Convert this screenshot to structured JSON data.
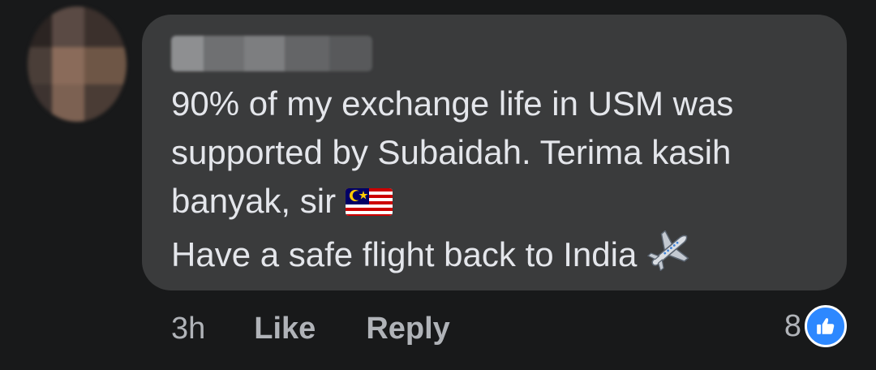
{
  "comment": {
    "author_name": "",
    "text_lines": [
      "90% of my exchange life in USM was",
      "supported by Subaidah. Terima kasih",
      "banyak, sir",
      "Have a safe flight back to India"
    ],
    "emojis": [
      "malaysia-flag-icon",
      "airplane-icon"
    ]
  },
  "actions": {
    "timestamp": "3h",
    "like_label": "Like",
    "reply_label": "Reply"
  },
  "reactions": {
    "count": "8",
    "icon": "thumbs-up-icon"
  },
  "colors": {
    "background": "#18191a",
    "bubble": "#3a3b3c",
    "text": "#e4e6eb",
    "secondary_text": "#b0b3b8",
    "like_blue": "#2d88ff"
  }
}
